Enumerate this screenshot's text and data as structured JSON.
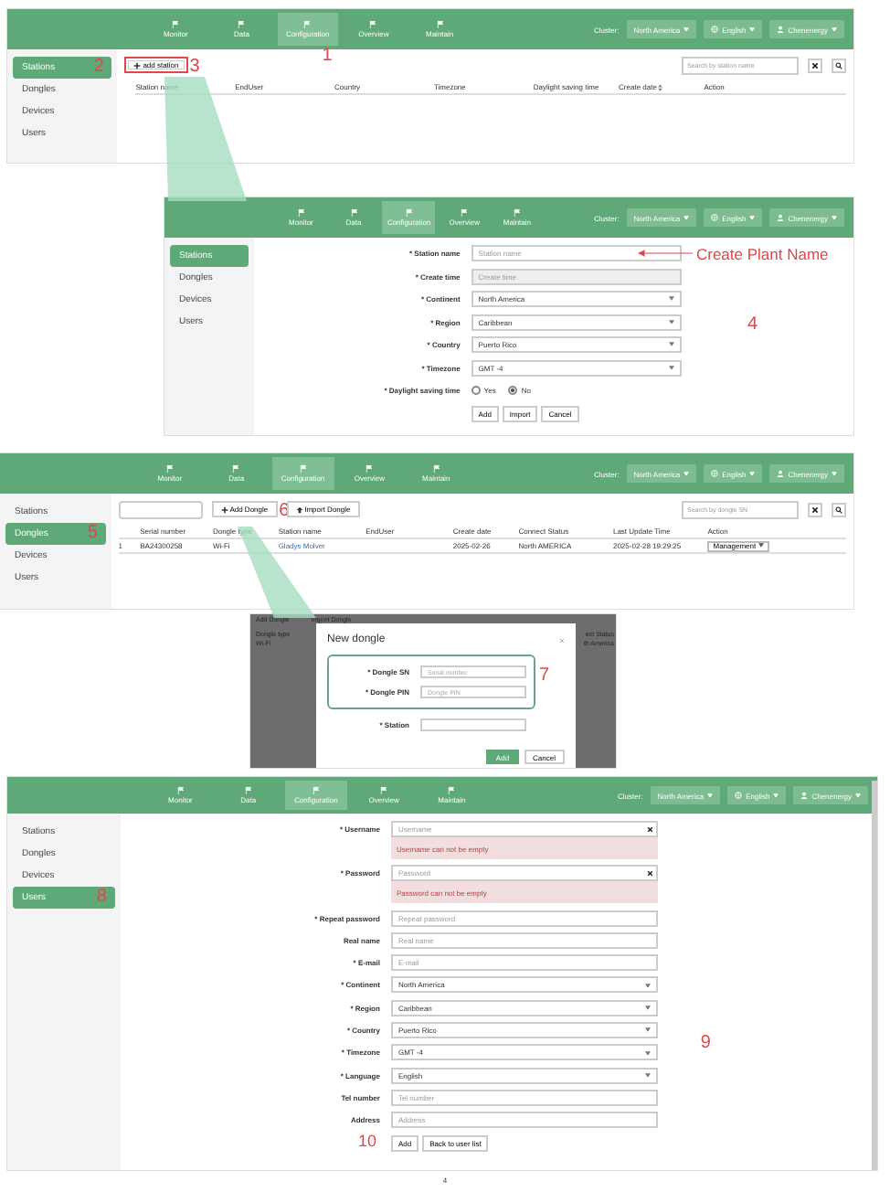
{
  "screens": [
    {
      "kind": "station-list",
      "nav": [
        {
          "label": "Monitor",
          "selected": false
        },
        {
          "label": "Data",
          "selected": false
        },
        {
          "label": "Configuration",
          "selected": true,
          "marker": "1"
        },
        {
          "label": "Overview",
          "selected": false
        },
        {
          "label": "Maintain",
          "selected": false
        }
      ],
      "cluster_label": "Cluster:",
      "cluster": "North America",
      "language": "English",
      "user": "Chenenergy",
      "sidebar": [
        {
          "label": "Stations",
          "selected": true,
          "marker": "2"
        },
        {
          "label": "Dongles",
          "selected": false
        },
        {
          "label": "Devices",
          "selected": false
        },
        {
          "label": "Users",
          "selected": false
        }
      ],
      "toolbar": [
        {
          "kind": "add",
          "label": "add station",
          "highlighted": true,
          "marker": "3"
        }
      ],
      "search": {
        "placeholder": "Search by station name"
      },
      "columns": [
        {
          "label": "Station name",
          "kind": "text"
        },
        {
          "label": "EndUser",
          "kind": "text"
        },
        {
          "label": "Country",
          "kind": "text"
        },
        {
          "label": "Timezone",
          "kind": "text"
        },
        {
          "label": "Daylight saving time",
          "kind": "text"
        },
        {
          "label": "Create date",
          "kind": "sortable"
        },
        {
          "label": "Action",
          "kind": "text"
        }
      ]
    },
    {
      "kind": "form",
      "nav": [
        {
          "label": "Monitor",
          "selected": false
        },
        {
          "label": "Data",
          "selected": false
        },
        {
          "label": "Configuration",
          "selected": true
        },
        {
          "label": "Overview",
          "selected": false
        },
        {
          "label": "Maintain",
          "selected": false
        }
      ],
      "cluster_label": "Cluster:",
      "cluster": "North America",
      "language": "English",
      "user": "Chenenergy",
      "sidebar": [
        {
          "label": "Stations",
          "selected": true
        },
        {
          "label": "Dongles",
          "selected": false
        },
        {
          "label": "Devices",
          "selected": false
        },
        {
          "label": "Users",
          "selected": false
        }
      ],
      "marker": "4",
      "fields": [
        {
          "label": "* Station name",
          "kind": "text",
          "placeholder": "Station name",
          "callout": "Create Plant Name"
        },
        {
          "label": "* Create time",
          "kind": "disabled",
          "placeholder": "Create time"
        },
        {
          "label": "* Continent",
          "kind": "select",
          "value": "North America"
        },
        {
          "label": "* Region",
          "kind": "select",
          "value": "Caribbean"
        },
        {
          "label": "* Country",
          "kind": "select",
          "value": "Puerto Rico"
        },
        {
          "label": "* Timezone",
          "kind": "select",
          "value": "GMT -4"
        },
        {
          "label": "* Daylight saving time",
          "kind": "radio",
          "options": [
            {
              "label": "Yes",
              "selected": false
            },
            {
              "label": "No",
              "selected": true
            }
          ]
        }
      ],
      "actions": [
        {
          "label": "Add"
        },
        {
          "label": "Import"
        },
        {
          "label": "Cancel"
        }
      ]
    },
    {
      "kind": "dongle-list",
      "nav": [
        {
          "label": "Monitor",
          "selected": false
        },
        {
          "label": "Data",
          "selected": false
        },
        {
          "label": "Configuration",
          "selected": true
        },
        {
          "label": "Overview",
          "selected": false
        },
        {
          "label": "Maintain",
          "selected": false
        }
      ],
      "cluster_label": "Cluster:",
      "cluster": "North America",
      "language": "English",
      "user": "Chenenergy",
      "sidebar": [
        {
          "label": "Stations",
          "selected": false
        },
        {
          "label": "Dongles",
          "selected": true,
          "marker": "5"
        },
        {
          "label": "Devices",
          "selected": false
        },
        {
          "label": "Users",
          "selected": false
        }
      ],
      "toolbar": [
        {
          "kind": "filter"
        },
        {
          "kind": "add",
          "label": "Add Dongle",
          "highlighted": false,
          "marker": "6"
        },
        {
          "kind": "import",
          "label": "Import Dongle",
          "highlighted": false
        }
      ],
      "search": {
        "placeholder": "Search by dongle SN"
      },
      "columns": [
        {
          "label": "Serial number",
          "kind": "text"
        },
        {
          "label": "Dongle type",
          "kind": "text"
        },
        {
          "label": "Station name",
          "kind": "link"
        },
        {
          "label": "EndUser",
          "kind": "text"
        },
        {
          "label": "Create date",
          "kind": "text"
        },
        {
          "label": "Connect Status",
          "kind": "text"
        },
        {
          "label": "Last Update Time",
          "kind": "text"
        },
        {
          "label": "Action",
          "kind": "menu"
        }
      ],
      "rows": [
        {
          "number": "1",
          "cells": [
            "BA24300258",
            "Wi-Fi",
            "Gladys Molver",
            null,
            "2025-02-26",
            "North AMERICA",
            "2025-02-28 19:29:25",
            "Management"
          ]
        }
      ]
    },
    {
      "kind": "dialog",
      "backdrop_top": [
        "Add Dongle",
        "Import Dongle"
      ],
      "backdrop_left": [
        "Dongle type",
        "Wi-Fi"
      ],
      "backdrop_right": [
        "ect Status",
        "th America"
      ],
      "title": "New dongle",
      "marker": "7",
      "fields": [
        {
          "label": "* Dongle SN",
          "kind": "text",
          "placeholder": "Serial number",
          "highlighted": true
        },
        {
          "label": "* Dongle PIN",
          "kind": "text",
          "placeholder": "Dongle PIN",
          "highlighted": true
        },
        {
          "label": "* Station",
          "kind": "select",
          "highlighted": false
        }
      ],
      "buttons": [
        {
          "label": "Add",
          "primary": true
        },
        {
          "label": "Cancel",
          "primary": false
        }
      ]
    },
    {
      "kind": "form",
      "nav": [
        {
          "label": "Monitor",
          "selected": false
        },
        {
          "label": "Data",
          "selected": false
        },
        {
          "label": "Configuration",
          "selected": true
        },
        {
          "label": "Overview",
          "selected": false
        },
        {
          "label": "Maintain",
          "selected": false
        }
      ],
      "cluster_label": "Cluster:",
      "cluster": "North America",
      "language": "English",
      "user": "Chenenergy",
      "sidebar": [
        {
          "label": "Stations",
          "selected": false
        },
        {
          "label": "Dongles",
          "selected": false
        },
        {
          "label": "Devices",
          "selected": false
        },
        {
          "label": "Users",
          "selected": true,
          "marker": "8"
        }
      ],
      "marker": "9",
      "scrollbar": true,
      "fields": [
        {
          "label": "* Username",
          "kind": "text",
          "placeholder": "Username",
          "clearable": true,
          "error": "Username can not be empty"
        },
        {
          "label": "* Password",
          "kind": "text",
          "placeholder": "Password",
          "clearable": true,
          "error": "Password can not be empty"
        },
        {
          "label": "* Repeat password",
          "kind": "text",
          "placeholder": "Repeat password"
        },
        {
          "label": "Real name",
          "kind": "text",
          "placeholder": "Real name"
        },
        {
          "label": "* E-mail",
          "kind": "text",
          "placeholder": "E-mail"
        },
        {
          "label": "* Continent",
          "kind": "select",
          "value": "North America"
        },
        {
          "label": "* Region",
          "kind": "select",
          "value": "Caribbean"
        },
        {
          "label": "* Country",
          "kind": "select",
          "value": "Puerto Rico"
        },
        {
          "label": "* Timezone",
          "kind": "select",
          "value": "GMT -4"
        },
        {
          "label": "* Language",
          "kind": "select",
          "value": "English"
        },
        {
          "label": "Tel number",
          "kind": "text",
          "placeholder": "Tel number"
        },
        {
          "label": "Address",
          "kind": "text",
          "placeholder": "Address"
        }
      ],
      "actions_marker": "10",
      "actions": [
        {
          "label": "Add"
        },
        {
          "label": "Back to user list"
        }
      ]
    }
  ],
  "page_number": "4"
}
